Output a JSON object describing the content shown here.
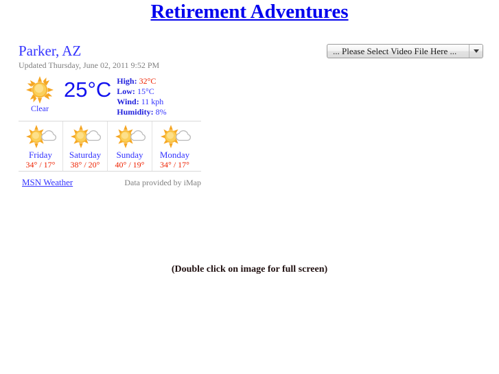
{
  "page": {
    "title": "Retirement Adventures",
    "hint": "(Double click on image for full screen)",
    "background": "#ffffff",
    "title_color": "#0000ee"
  },
  "video_select": {
    "selected": "... Please Select Video File Here ...",
    "arrow_icon": "chevron-down-icon"
  },
  "weather": {
    "city": "Parker, AZ",
    "updated": "Updated Thursday, June 02, 2011 9:52 PM",
    "current": {
      "icon": "sunny-icon",
      "condition": "Clear",
      "temperature": "25°C",
      "stats": [
        {
          "label": "High:",
          "value": "32°C",
          "color": "#ee2200"
        },
        {
          "label": "Low:",
          "value": "15°C",
          "color": "#3333ff"
        },
        {
          "label": "Wind:",
          "value": "11 kph",
          "color": "#3333ff"
        },
        {
          "label": "Humidity:",
          "value": "8%",
          "color": "#3333ff"
        }
      ]
    },
    "forecast": [
      {
        "day": "Friday",
        "temps": "34° / 17°",
        "icon": "partly-sunny-icon"
      },
      {
        "day": "Saturday",
        "temps": "38° / 20°",
        "icon": "partly-sunny-icon"
      },
      {
        "day": "Sunday",
        "temps": "40° / 19°",
        "icon": "partly-sunny-icon"
      },
      {
        "day": "Monday",
        "temps": "34° / 17°",
        "icon": "partly-sunny-icon"
      }
    ],
    "footer": {
      "link": "MSN Weather",
      "credit": "Data provided by iMap"
    }
  }
}
